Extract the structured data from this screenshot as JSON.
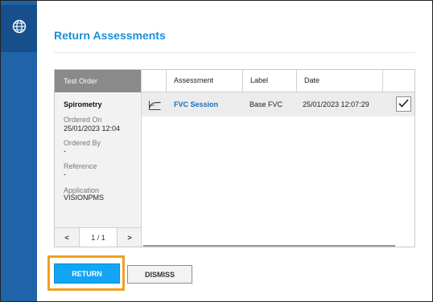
{
  "page": {
    "title": "Return Assessments"
  },
  "sidebar": {
    "icon": "globe-icon"
  },
  "test_order": {
    "header": "Test Order",
    "name": "Spirometry",
    "ordered_on_label": "Ordered On",
    "ordered_on_value": "25/01/2023 12:04",
    "ordered_by_label": "Ordered By",
    "ordered_by_value": "-",
    "reference_label": "Reference",
    "reference_value": "-",
    "application_label": "Application",
    "application_value": "VISIONPMS",
    "pager": {
      "prev": "<",
      "count": "1 / 1",
      "next": ">"
    }
  },
  "table": {
    "columns": [
      "Assessment",
      "Label",
      "Date"
    ],
    "rows": [
      {
        "icon": "spirometry-curve-icon",
        "assessment": "FVC Session",
        "label": "Base FVC",
        "date": "25/01/2023 12:07:29",
        "checked": true
      }
    ]
  },
  "buttons": {
    "return": "RETURN",
    "dismiss": "DISMISS"
  },
  "colors": {
    "sidebar": "#1f63a8",
    "accent": "#10a6f5",
    "title": "#1a8fd9",
    "highlight": "#f0a020"
  }
}
